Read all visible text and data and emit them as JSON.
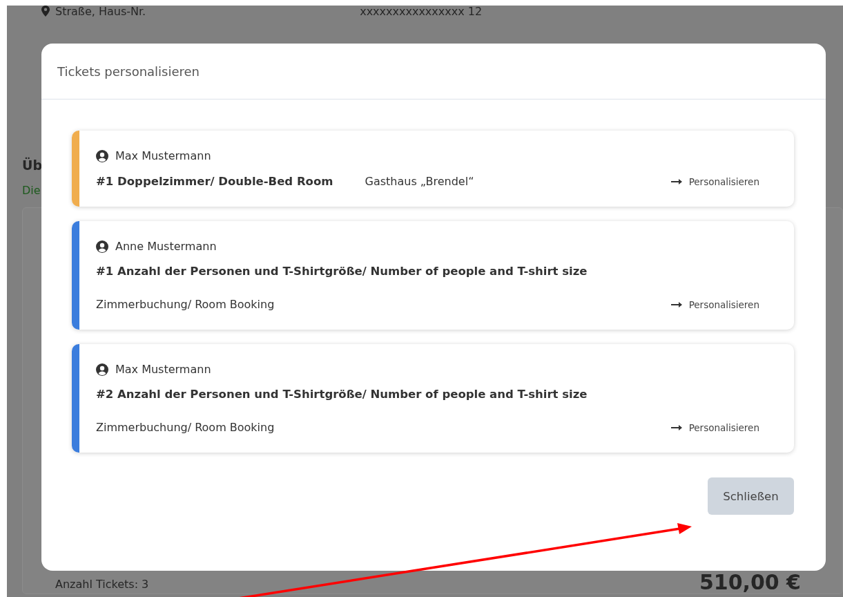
{
  "background_page": {
    "address_label": "Straße, Haus-Nr.",
    "address_value": "xxxxxxxxxxxxxxxx 12",
    "section_heading": "Üb",
    "section_note": "Die",
    "ticket_count": "Anzahl Tickets: 3",
    "total": "510,00 €"
  },
  "modal": {
    "title": "Tickets personalisieren",
    "tickets": [
      {
        "kind": "inline",
        "color": "#f0ad4e",
        "holder": "Max Mustermann",
        "title": "#1 Doppelzimmer/ Double-Bed Room",
        "detail": "Gasthaus „Brendel“",
        "action": "Personalisieren"
      },
      {
        "kind": "stacked",
        "color": "#3b7ddd",
        "holder": "Anne Mustermann",
        "title": "#1 Anzahl der Personen und T-Shirtgröße/ Number of people and T-shirt size",
        "detail": "Zimmerbuchung/ Room Booking",
        "action": "Personalisieren"
      },
      {
        "kind": "stacked",
        "color": "#3b7ddd",
        "holder": "Max Mustermann",
        "title": "#2 Anzahl der Personen und T-Shirtgröße/ Number of people and T-shirt size",
        "detail": "Zimmerbuchung/ Room Booking",
        "action": "Personalisieren"
      }
    ],
    "close_button": "Schließen"
  }
}
